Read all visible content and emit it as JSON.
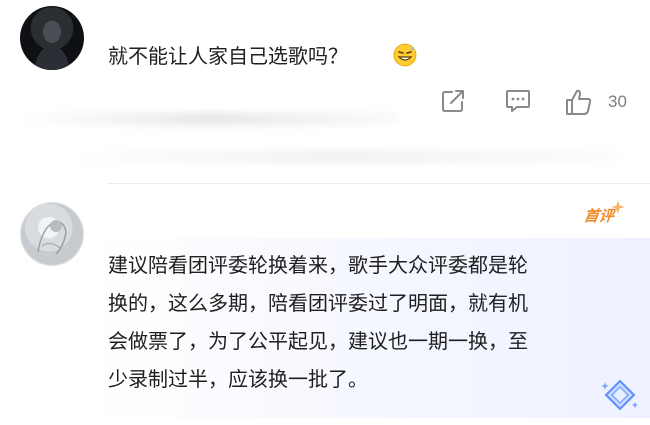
{
  "comments": [
    {
      "text": "就不能让人家自己选歌吗？",
      "emoji": "grinning-sweat-emoji",
      "actions": {
        "share_icon": "share-icon",
        "comment_icon": "comment-icon",
        "like_icon": "thumbs-up-icon",
        "like_count": "30"
      }
    },
    {
      "badge": "首评",
      "lines": [
        "建议陪看团评委轮换着来，歌手大众评委都是轮",
        "换的，这么多期，陪看团评委过了明面，就有机",
        "会做票了，为了公平起见，建议也一期一换，至",
        "少录制过半，应该换一批了。"
      ],
      "decoration_icon": "diamond-sparkle-icon"
    }
  ],
  "colors": {
    "badge": "#f08a2a",
    "action_icon": "#8a8a8a",
    "bubble_tint": "#eef2ff"
  }
}
